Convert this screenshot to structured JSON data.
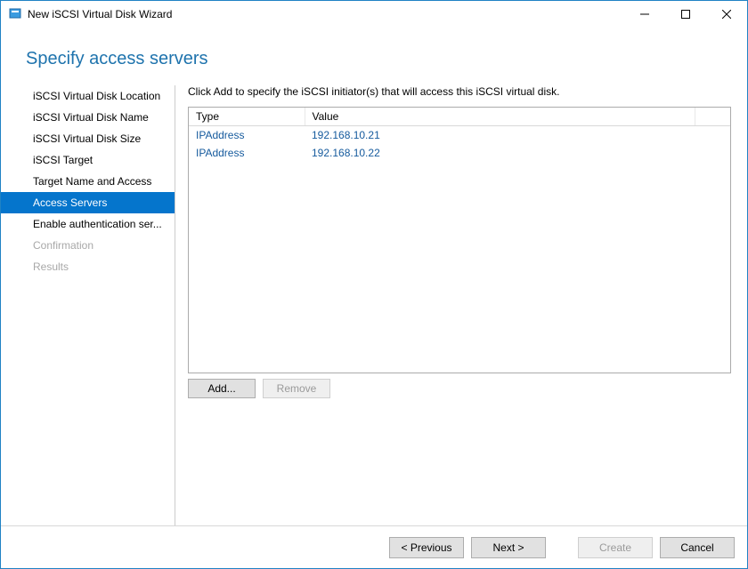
{
  "titlebar": {
    "title": "New iSCSI Virtual Disk Wizard"
  },
  "page_title": "Specify access servers",
  "sidebar": {
    "items": [
      {
        "label": "iSCSI Virtual Disk Location",
        "state": "normal"
      },
      {
        "label": "iSCSI Virtual Disk Name",
        "state": "normal"
      },
      {
        "label": "iSCSI Virtual Disk Size",
        "state": "normal"
      },
      {
        "label": "iSCSI Target",
        "state": "normal"
      },
      {
        "label": "Target Name and Access",
        "state": "normal"
      },
      {
        "label": "Access Servers",
        "state": "selected"
      },
      {
        "label": "Enable authentication ser...",
        "state": "normal"
      },
      {
        "label": "Confirmation",
        "state": "disabled"
      },
      {
        "label": "Results",
        "state": "disabled"
      }
    ]
  },
  "main": {
    "instruction": "Click Add to specify the iSCSI initiator(s) that will access this iSCSI virtual disk.",
    "columns": {
      "type": "Type",
      "value": "Value"
    },
    "rows": [
      {
        "type": "IPAddress",
        "value": "192.168.10.21"
      },
      {
        "type": "IPAddress",
        "value": "192.168.10.22"
      }
    ],
    "add_label": "Add...",
    "remove_label": "Remove"
  },
  "footer": {
    "previous": "< Previous",
    "next": "Next >",
    "create": "Create",
    "cancel": "Cancel"
  }
}
